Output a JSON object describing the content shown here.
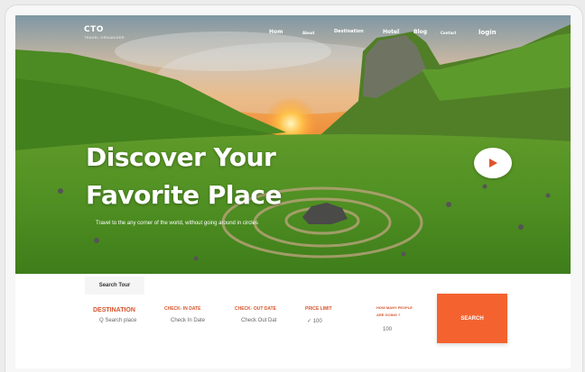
{
  "logo": {
    "title": "CTO",
    "subtitle": "TRAVEL ORGANIZER"
  },
  "nav": {
    "items": [
      {
        "label": "Hom"
      },
      {
        "label": "About"
      },
      {
        "label": "Destination"
      },
      {
        "label": "Hotel"
      },
      {
        "label": "Blog"
      },
      {
        "label": "Contact"
      },
      {
        "label": "login"
      }
    ]
  },
  "hero": {
    "headline_line1": "Discover Your",
    "headline_line2": "Favorite Place",
    "subtitle": "Travel to the any corner of the world, without going around in circles"
  },
  "search": {
    "tab_label": "Search Tour",
    "destination": {
      "label": "DESTINATION",
      "placeholder": "Q Search place"
    },
    "check_in": {
      "label": "CHECK- IN DATE",
      "placeholder": "Check In Date"
    },
    "check_out": {
      "label": "CHECK- OUT DATE",
      "placeholder": "Check Out Dat"
    },
    "price": {
      "label": "PRICE LIMIT",
      "value": "✓ 100"
    },
    "people": {
      "label_line1": "HOW MANY PEOPLE",
      "label_line2": "ARE GOING ?",
      "value": "100"
    },
    "button_label": "SEARCH"
  },
  "colors": {
    "accent": "#f4632f",
    "label": "#d4572e"
  }
}
